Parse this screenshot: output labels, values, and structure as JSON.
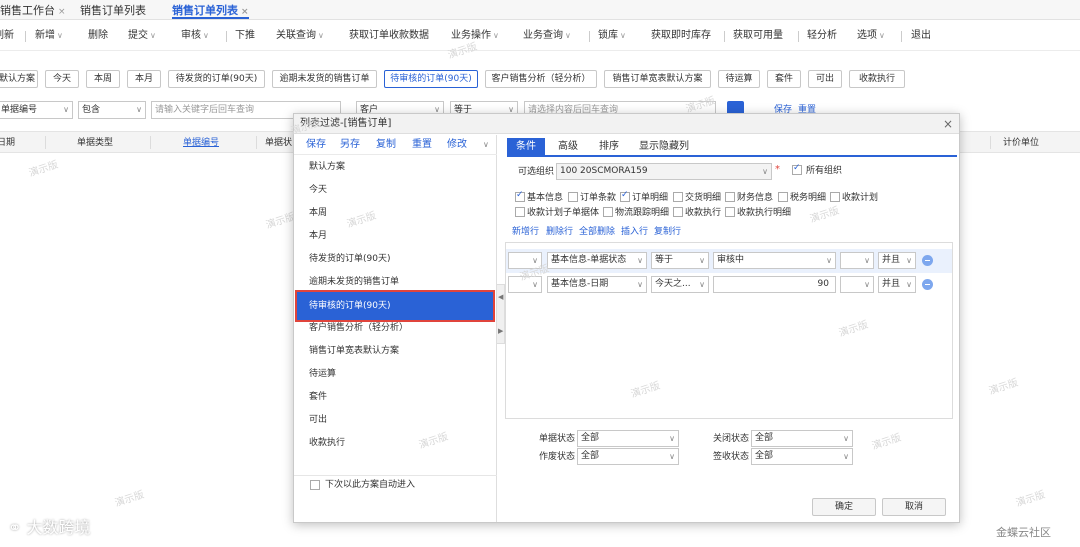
{
  "tabs": [
    {
      "label": "销售工作台",
      "close": "×"
    },
    {
      "label": "销售订单列表",
      "close": ""
    },
    {
      "label": "销售订单列表",
      "close": "×"
    }
  ],
  "toolbar": [
    "刷新",
    "新增",
    "删除",
    "提交",
    "审核",
    "下推",
    "关联查询",
    "获取订单收款数据",
    "业务操作",
    "业务查询",
    "锁库",
    "获取即时库存",
    "获取可用量",
    "轻分析",
    "选项",
    "退出"
  ],
  "schemes": [
    "默认方案",
    "今天",
    "本周",
    "本月",
    "待发货的订单(90天)",
    "逾期未发货的销售订单",
    "待审核的订单(90天)",
    "客户销售分析（轻分析）",
    "销售订单宽表默认方案",
    "待运算",
    "套件",
    "可出",
    "收款执行"
  ],
  "filter_bar": {
    "field": "单据编号",
    "op": "包含",
    "placeholder": "请输入关键字后回车查询",
    "field2": "客户",
    "op2": "等于",
    "placeholder2": "请选择内容后回车查询",
    "save": "保存",
    "reset": "重置"
  },
  "grid_headers": [
    "日期",
    "单据类型",
    "单据编号",
    "单据状",
    "计价单位"
  ],
  "watermark": "演示版",
  "modal": {
    "title": "列表过滤-[销售订单]",
    "close": "×",
    "left_actions": [
      "保存",
      "另存",
      "复制",
      "重置",
      "修改"
    ],
    "schemes": [
      "默认方案",
      "今天",
      "本周",
      "本月",
      "待发货的订单(90天)",
      "逾期未发货的销售订单",
      "待审核的订单(90天)",
      "客户销售分析（轻分析）",
      "销售订单宽表默认方案",
      "待运算",
      "套件",
      "可出",
      "收款执行"
    ],
    "auto_enter": "下次以此方案自动进入",
    "right_tabs": [
      "条件",
      "高级",
      "排序",
      "显示隐藏列"
    ],
    "org_label": "可选组织",
    "org_value": "100 20SCMORA159",
    "all_org": "所有组织",
    "checkbox_row1": [
      "基本信息",
      "订单条款",
      "订单明细",
      "交货明细",
      "财务信息",
      "税务明细",
      "收款计划"
    ],
    "checkbox_row2": [
      "收款计划子单据体",
      "物流跟踪明细",
      "收款执行",
      "收款执行明细"
    ],
    "checked": [
      "基本信息",
      "订单明细"
    ],
    "row_actions": [
      "新增行",
      "删除行",
      "全部删除",
      "插入行",
      "复制行"
    ],
    "conditions": [
      {
        "field": "基本信息-单据状态",
        "op": "等于",
        "value": "审核中",
        "logic": "并且"
      },
      {
        "field": "基本信息-日期",
        "op": "今天之...",
        "value": "90",
        "logic": "并且"
      }
    ],
    "status_fields": [
      {
        "label": "单据状态",
        "value": "全部"
      },
      {
        "label": "关闭状态",
        "value": "全部"
      },
      {
        "label": "作废状态",
        "value": "全部"
      },
      {
        "label": "签收状态",
        "value": "全部"
      }
    ],
    "ok": "确定",
    "cancel": "取消"
  },
  "brand_left": "大数跨境",
  "brand_right": "金蝶云社区"
}
